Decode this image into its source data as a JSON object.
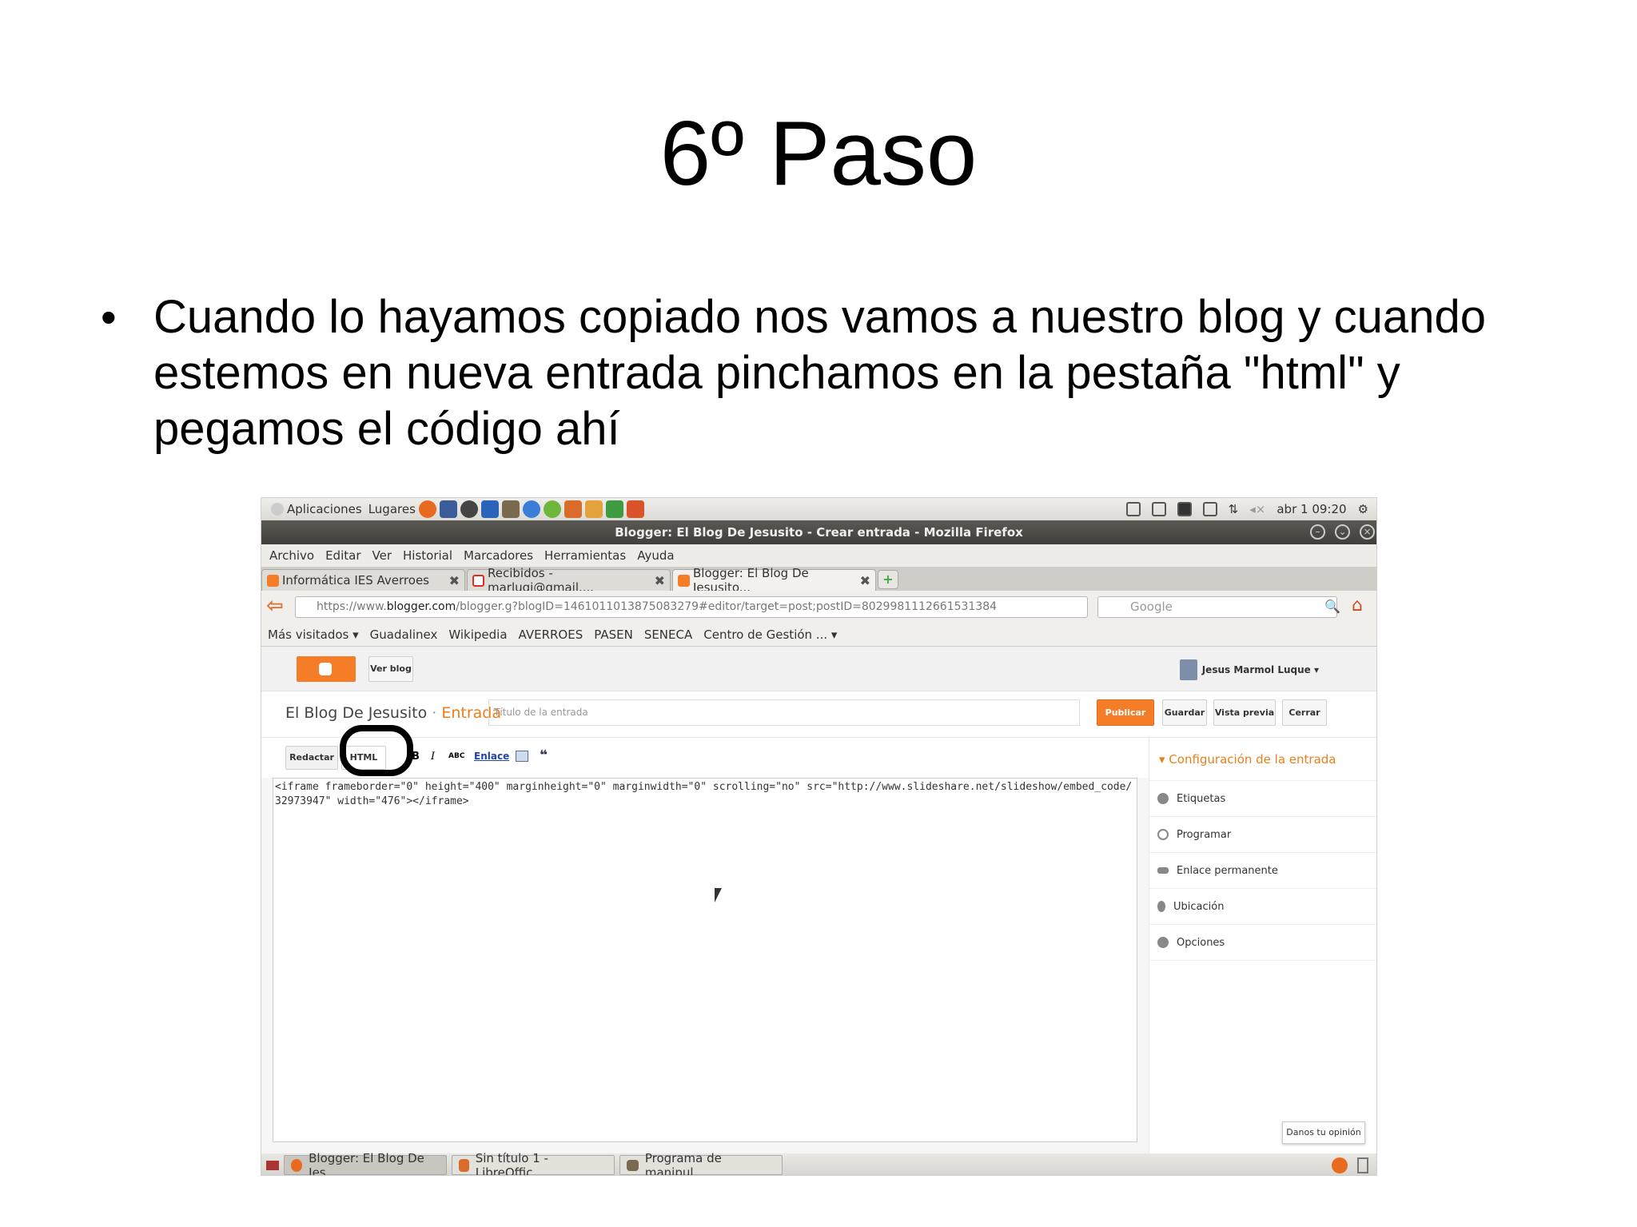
{
  "slide": {
    "title": "6º Paso",
    "bullet": "•",
    "text": "Cuando lo hayamos copiado nos vamos a nuestro blog y cuando estemos en nueva entrada pinchamos en la pestaña \"html\" y pegamos el código ahí"
  },
  "screenshot": {
    "panel": {
      "apps": "Aplicaciones",
      "places": "Lugares",
      "datetime": "abr  1 09:20"
    },
    "window_title": "Blogger: El Blog De Jesusito - Crear entrada - Mozilla Firefox",
    "menu": [
      "Archivo",
      "Editar",
      "Ver",
      "Historial",
      "Marcadores",
      "Herramientas",
      "Ayuda"
    ],
    "tabs": [
      {
        "label": "Informática IES Averroes",
        "color": "#f57d28"
      },
      {
        "label": "Recibidos - marluqj@gmail....",
        "color": "#d93025"
      },
      {
        "label": "Blogger: El Blog De Jesusito...",
        "color": "#f57d28"
      }
    ],
    "url": {
      "prefix": "https://www.",
      "domain": "blogger.com",
      "path": "/blogger.g?blogID=1461011013875083279#editor/target=post;postID=8029981112661531384"
    },
    "search_placeholder": "Google",
    "bookmarks": [
      "Más visitados ▾",
      "Guadalinex",
      "Wikipedia",
      "AVERROES",
      "PASEN",
      "SENECA",
      "Centro de Gestión ... ▾"
    ],
    "header": {
      "view_blog": "Ver blog",
      "user": "Jesus Marmol Luque ▾"
    },
    "editor": {
      "blog_name": "El Blog De Jesusito",
      "separator": " · ",
      "entry": "Entrada",
      "title_placeholder": "Título de la entrada",
      "publish": "Publicar",
      "save": "Guardar",
      "preview": "Vista previa",
      "close": "Cerrar",
      "compose": "Redactar",
      "html": "HTML",
      "bold": "B",
      "italic": "I",
      "spell": "ABC",
      "link": "Enlace",
      "quote": "❝",
      "code": "<iframe frameborder=\"0\" height=\"400\" marginheight=\"0\" marginwidth=\"0\" scrolling=\"no\" src=\"http://www.slideshare.net/slideshow/embed_code/32973947\" width=\"476\"></iframe>"
    },
    "sidebar": {
      "heading": "▾  Configuración de la entrada",
      "items": [
        "Etiquetas",
        "Programar",
        "Enlace permanente",
        "Ubicación",
        "Opciones"
      ]
    },
    "feedback": "Danos tu opinión",
    "taskbar": [
      "Blogger: El Blog De Jes...",
      "Sin título 1 - LibreOffic...",
      "Programa de manipul..."
    ]
  }
}
